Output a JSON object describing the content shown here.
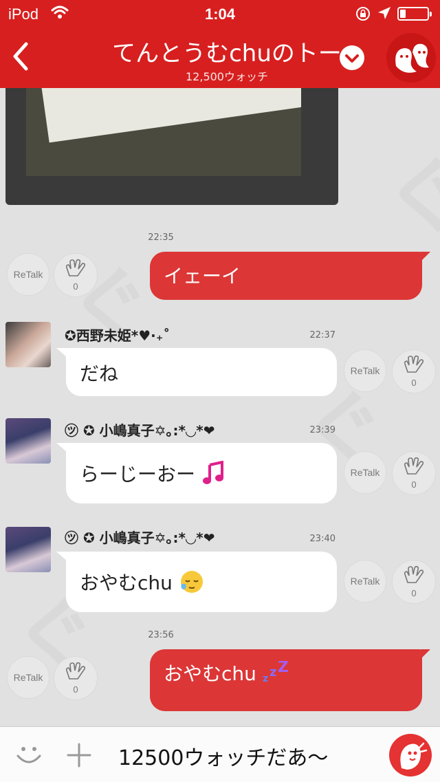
{
  "status_bar": {
    "carrier": "iPod",
    "time": "1:04"
  },
  "header": {
    "back_icon": "chevron-left-icon",
    "title": "てんとうむchuのトー",
    "subtitle": "12,500ウォッチ",
    "dropdown_icon": "chevron-down-icon",
    "mascot_icon": "mascot-icon"
  },
  "messages": [
    {
      "type": "timestamp",
      "time": "22:35"
    },
    {
      "type": "outgoing",
      "text": "イェーイ",
      "retalk": "ReTalk",
      "claps": "0"
    },
    {
      "type": "incoming",
      "sender": "✪西野未姫*♥·₊˚",
      "time": "22:37",
      "text": "だね",
      "retalk": "ReTalk",
      "claps": "0"
    },
    {
      "type": "incoming",
      "sender": "㋡ ✪ 小嶋真子✡｡:*◡*❤",
      "time": "23:39",
      "text": "らーじーおー",
      "emoji": "musical-note-emoji",
      "retalk": "ReTalk",
      "claps": "0"
    },
    {
      "type": "incoming",
      "sender": "㋡ ✪ 小嶋真子✡｡:*◡*❤",
      "time": "23:40",
      "text": "おやむchu",
      "emoji": "sleepy-face-emoji",
      "retalk": "ReTalk",
      "claps": "0"
    },
    {
      "type": "timestamp",
      "time": "23:56"
    },
    {
      "type": "outgoing",
      "text": "おやむchu",
      "emoji": "zzz-emoji",
      "retalk": "ReTalk",
      "claps": "0"
    }
  ],
  "input": {
    "text": "12500ウォッチだあ〜",
    "emoji_icon": "smiley-icon",
    "add_icon": "plus-icon",
    "send_icon": "mascot-send-icon"
  },
  "colors": {
    "brand_red": "#d71f1f",
    "bubble_out": "#dc3636",
    "bubble_in": "#ffffff",
    "background": "#e1e1e1"
  }
}
